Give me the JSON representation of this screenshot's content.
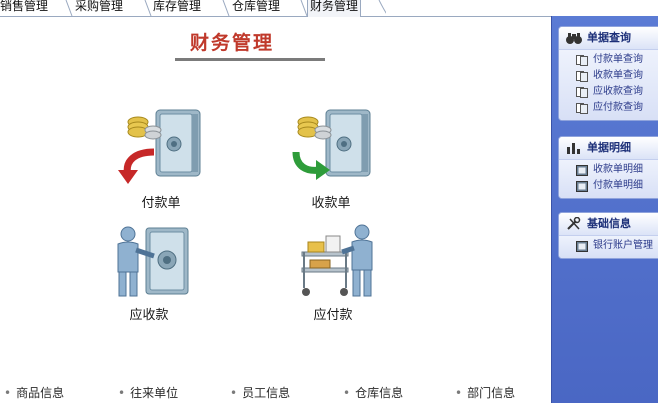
{
  "tabs": [
    {
      "label": "销售管理",
      "active": false
    },
    {
      "label": "采购管理",
      "active": false
    },
    {
      "label": "库存管理",
      "active": false
    },
    {
      "label": "仓库管理",
      "active": false
    },
    {
      "label": "财务管理",
      "active": true
    }
  ],
  "main": {
    "title": "财务管理",
    "features": [
      {
        "label": "付款单",
        "icon": "safe-with-coins-red-arrow-icon"
      },
      {
        "label": "收款单",
        "icon": "safe-with-coins-green-arrow-icon"
      },
      {
        "label": "应收款",
        "icon": "person-at-safe-icon"
      },
      {
        "label": "应付款",
        "icon": "person-with-cart-icon"
      }
    ],
    "bottom_links": [
      "商品信息",
      "往来单位",
      "员工信息",
      "仓库信息",
      "部门信息"
    ]
  },
  "sidebar": {
    "groups": [
      {
        "title": "单据查询",
        "icon": "binoculars-icon",
        "items": [
          "付款单查询",
          "收款单查询",
          "应收款查询",
          "应付款查询"
        ]
      },
      {
        "title": "单据明细",
        "icon": "bar-chart-icon",
        "items": [
          "收款单明细",
          "付款单明细"
        ]
      },
      {
        "title": "基础信息",
        "icon": "tools-icon",
        "items": [
          "银行账户管理"
        ]
      }
    ]
  },
  "colors": {
    "title": "#c0392b",
    "sidebar_bg": "#5b7bd4",
    "link": "#2b3a8a"
  }
}
